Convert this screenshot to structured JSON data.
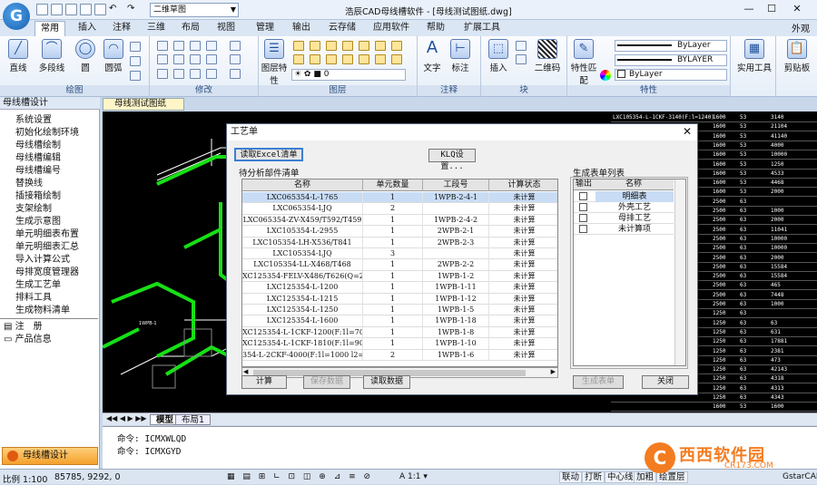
{
  "app": {
    "logo": "G",
    "workspace": "二维草图",
    "title": "浩辰CAD母线槽软件 - [母线测试图纸.dwg]",
    "waiguan": "外观"
  },
  "menu_tabs": [
    "常用",
    "插入",
    "注释",
    "三维",
    "布局",
    "视图",
    "管理",
    "输出",
    "云存储",
    "应用软件",
    "帮助",
    "扩展工具"
  ],
  "ribbon": {
    "draw": {
      "label": "绘图",
      "btns": [
        "直线",
        "多段线",
        "圆",
        "圆弧"
      ]
    },
    "modify": {
      "label": "修改"
    },
    "layer": {
      "label": "图层",
      "btn": "图层特性",
      "current": "0"
    },
    "annot": {
      "label": "注释",
      "btns": [
        "文字",
        "标注"
      ]
    },
    "block": {
      "label": "块",
      "btns": [
        "插入",
        "二维码"
      ]
    },
    "props": {
      "label": "特性",
      "btn": "特性匹配",
      "rows": [
        "ByLayer",
        "BYLAYER",
        "ByLayer"
      ]
    },
    "util": [
      "实用工具",
      "剪贴板"
    ]
  },
  "sidebar": {
    "title": "母线槽设计",
    "items": [
      "系统设置",
      "初始化绘制环境",
      "母线槽绘制",
      "母线槽编辑",
      "母线槽编号",
      "替换线",
      "插接箱绘制",
      "支架绘制",
      "生成示意图",
      "单元明细表布置",
      "单元明细表汇总",
      "导入计算公式",
      "母排宽度管理器",
      "生成工艺单",
      "排料工具",
      "生成物料清单"
    ],
    "extra": [
      "注　册",
      "产品信息"
    ],
    "bottom": "母线槽设计"
  },
  "doc_tab": "母线测试图纸",
  "layout_tabs": [
    "模型",
    "布局1"
  ],
  "cmd": [
    "命令: ICMXWLQD",
    "命令: ICMXGYD"
  ],
  "status": {
    "scale": "比例 1:100",
    "coords": "85785, 9292, 0",
    "buttons": [
      "联动",
      "打断",
      "中心线",
      "加粗",
      "绘置层"
    ],
    "brand": "GstarCAD"
  },
  "watermark": {
    "logo": "C",
    "text": "西西软件园",
    "sub": "CR173.COM"
  },
  "dialog": {
    "title": "工艺单",
    "btn_read_excel": "读取Excel清单",
    "btn_klq": "KLQ设置...",
    "list_label": "待分析部件清单",
    "headers": [
      "名称",
      "单元数量",
      "工段号",
      "计算状态"
    ],
    "rows": [
      [
        "LXC065354-L-1765",
        "1",
        "1WPB-2-4-1",
        "未计算"
      ],
      [
        "LXC065354-LJQ",
        "2",
        "",
        "未计算"
      ],
      [
        "LXC065354-ZV-X459/T592/T459",
        "1",
        "1WPB-2-4-2",
        "未计算"
      ],
      [
        "LXC105354-L-2955",
        "1",
        "2WPB-2-1",
        "未计算"
      ],
      [
        "LXC105354-LH-X536/T841",
        "1",
        "2WPB-2-3",
        "未计算"
      ],
      [
        "LXC105354-LJQ",
        "3",
        "",
        "未计算"
      ],
      [
        "LXC105354-LL-X468/T468",
        "1",
        "2WPB-2-2",
        "未计算"
      ],
      [
        "XC125354-FELV-X486/T626(Q=210",
        "1",
        "1WPB-1-2",
        "未计算"
      ],
      [
        "LXC125354-L-1200",
        "1",
        "1WPB-1-11",
        "未计算"
      ],
      [
        "LXC125354-L-1215",
        "1",
        "1WPB-1-12",
        "未计算"
      ],
      [
        "LXC125354-L-1250",
        "1",
        "1WPB-1-5",
        "未计算"
      ],
      [
        "LXC125354-L-1600",
        "1",
        "1WPB-1-18",
        "未计算"
      ],
      [
        "XC125354-L-1CKF-1200(F:1l=700",
        "1",
        "1WPB-1-8",
        "未计算"
      ],
      [
        "XC125354-L-1CKF-1810(F:1l=905",
        "1",
        "1WPB-1-10",
        "未计算"
      ],
      [
        "354-L-2CKF-4000(F:1l=1000 l2=",
        "2",
        "1WPB-1-6",
        "未计算"
      ]
    ],
    "out_label": "生成表单列表",
    "out_headers": [
      "输出",
      "名称"
    ],
    "out_rows": [
      "明细表",
      "外壳工艺",
      "母排工艺",
      "未计算项"
    ],
    "btn_calc": "计算",
    "btn_save": "保存数据",
    "btn_read": "读取数据",
    "btn_gen": "生成表单",
    "btn_close": "关闭"
  },
  "rtable_rows": [
    [
      "LXC105354-L-1CKF-3140(F:l=1240)",
      "1600",
      "53",
      "3140"
    ],
    [
      "",
      "1600",
      "53",
      "21104"
    ],
    [
      "",
      "1600",
      "53",
      "41140"
    ],
    [
      "",
      "1600",
      "53",
      "4000"
    ],
    [
      "",
      "1600",
      "53",
      "10000"
    ],
    [
      "",
      "1600",
      "53",
      "1250"
    ],
    [
      "",
      "1600",
      "53",
      "4533"
    ],
    [
      "",
      "1600",
      "53",
      "4468"
    ],
    [
      "",
      "1600",
      "53",
      "2000"
    ],
    [
      "",
      "2500",
      "63",
      ""
    ],
    [
      "",
      "2500",
      "63",
      "1000"
    ],
    [
      "",
      "2500",
      "63",
      "2000"
    ],
    [
      "",
      "2500",
      "63",
      "11041"
    ],
    [
      "",
      "2500",
      "63",
      "10000"
    ],
    [
      "",
      "2500",
      "63",
      "10000"
    ],
    [
      "",
      "2500",
      "63",
      "2000"
    ],
    [
      "",
      "2500",
      "63",
      "15584"
    ],
    [
      "",
      "2500",
      "63",
      "15584"
    ],
    [
      "",
      "2500",
      "63",
      "465"
    ],
    [
      "",
      "2500",
      "63",
      "7448"
    ],
    [
      "",
      "2500",
      "63",
      "1000"
    ],
    [
      "",
      "1250",
      "63",
      ""
    ],
    [
      "",
      "1250",
      "63",
      "63"
    ],
    [
      "",
      "1250",
      "63",
      "631"
    ],
    [
      "",
      "1250",
      "63",
      "17881"
    ],
    [
      "",
      "1250",
      "63",
      "2381"
    ],
    [
      "",
      "1250",
      "63",
      "473"
    ],
    [
      "",
      "1250",
      "63",
      "42143"
    ],
    [
      "",
      "1250",
      "63",
      "4318"
    ],
    [
      "",
      "1250",
      "63",
      "4313"
    ],
    [
      "",
      "1250",
      "63",
      "4343"
    ],
    [
      "",
      "1600",
      "53",
      "1600"
    ]
  ]
}
